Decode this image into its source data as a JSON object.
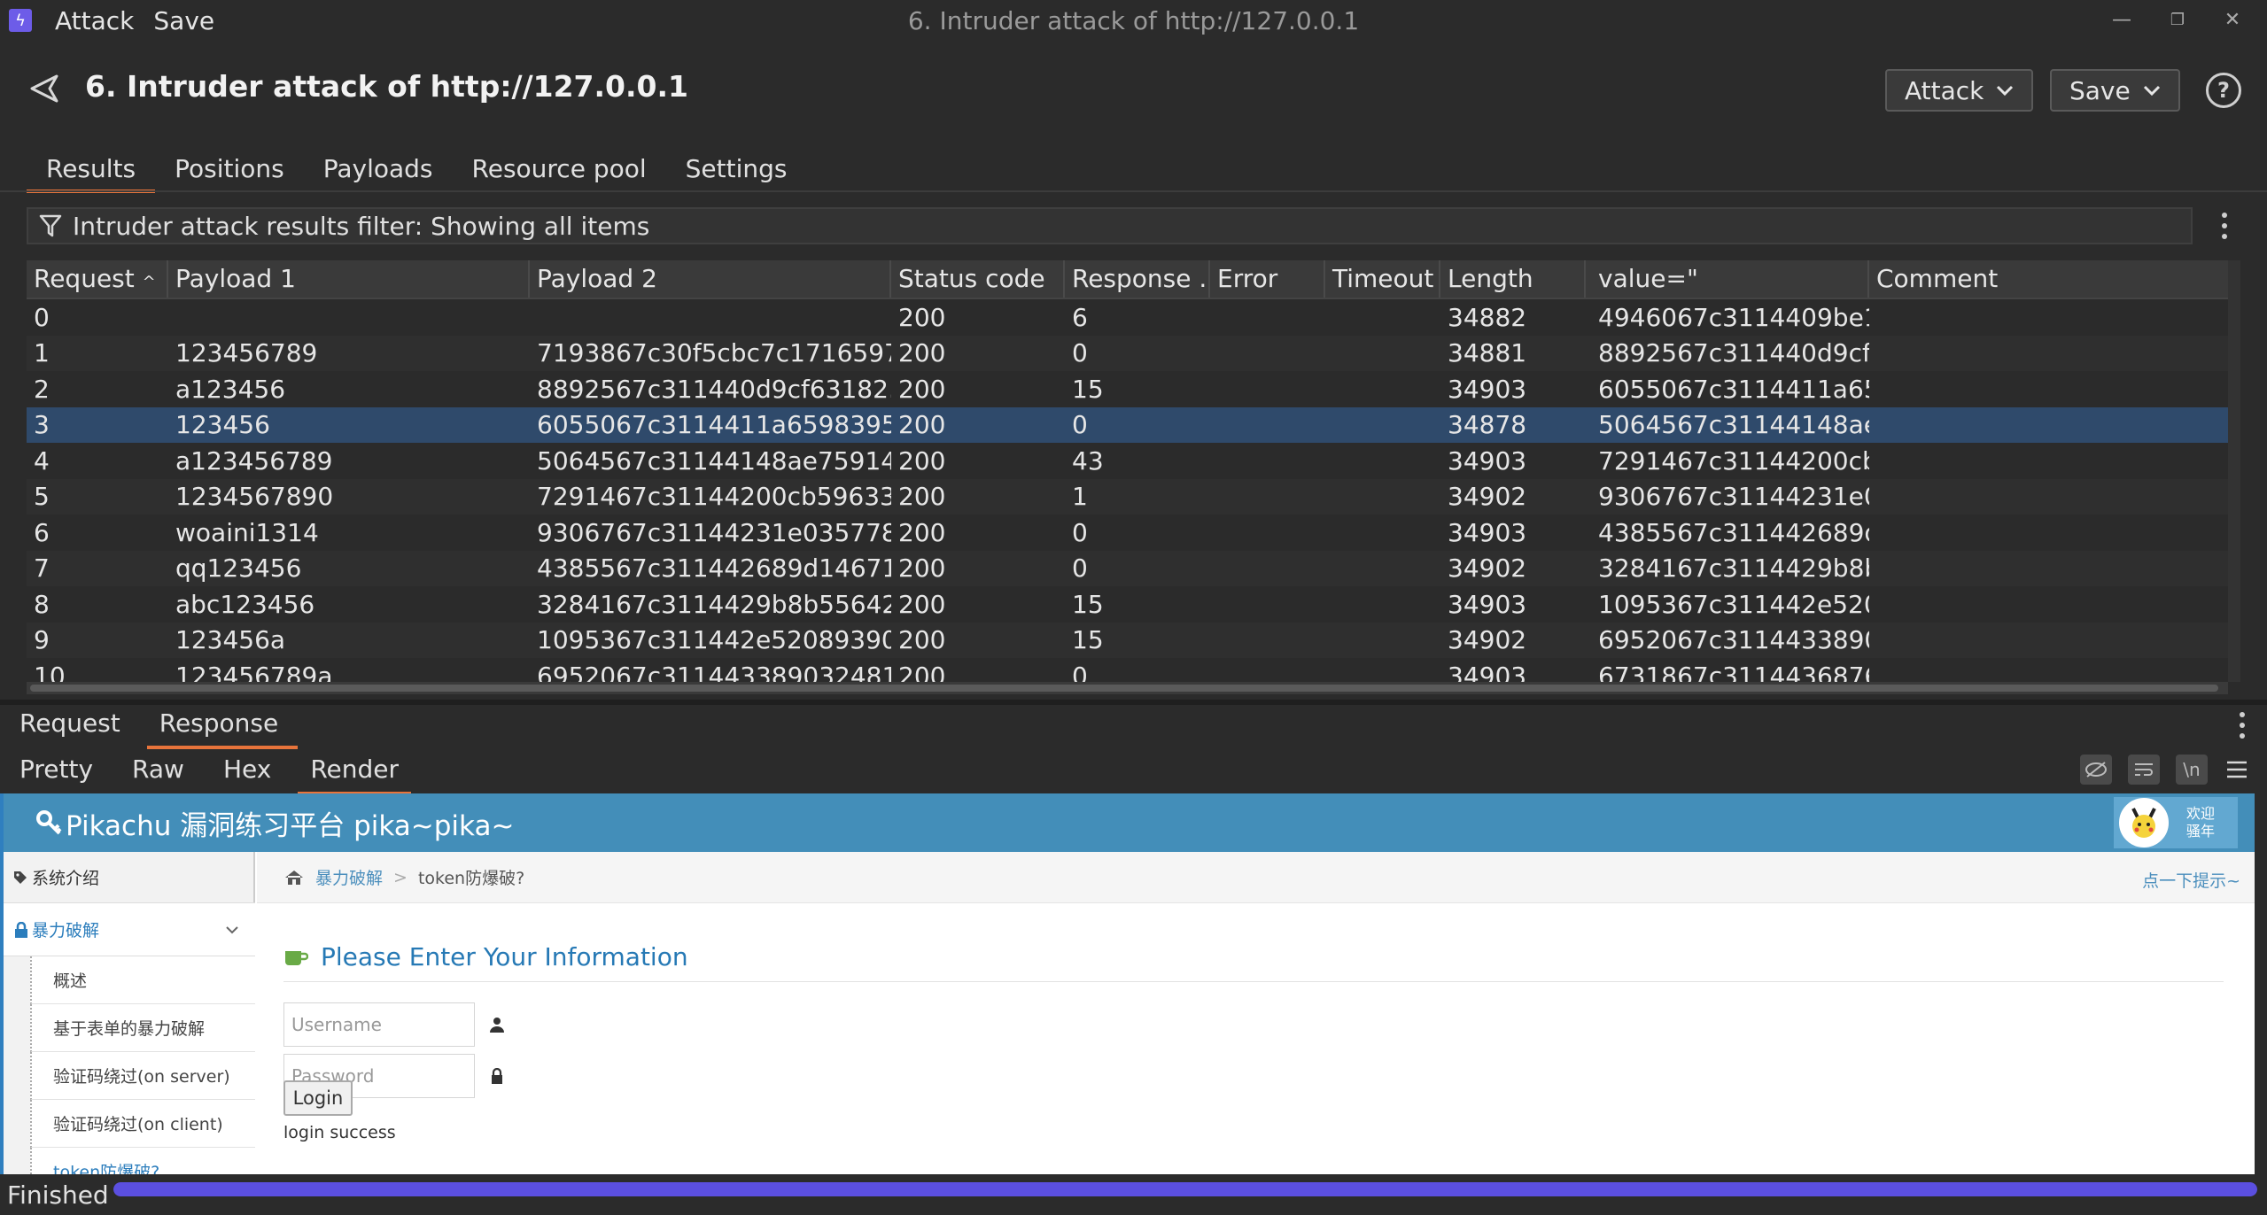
{
  "titlebar": {
    "menu": [
      "Attack",
      "Save"
    ],
    "window_title": "6. Intruder attack of http://127.0.0.1",
    "minimize": "—",
    "restore": "❐",
    "close": "✕"
  },
  "header": {
    "title": "6. Intruder attack of http://127.0.0.1",
    "attack_button": "Attack",
    "save_button": "Save",
    "help": "?"
  },
  "tabs": [
    "Results",
    "Positions",
    "Payloads",
    "Resource pool",
    "Settings"
  ],
  "filter": {
    "text": "Intruder attack results filter: Showing all items"
  },
  "table": {
    "columns": [
      "Request",
      "Payload 1",
      "Payload 2",
      "Status code",
      "Response ...",
      "Error",
      "Timeout",
      "Length",
      "value=\"",
      "Comment"
    ],
    "rows": [
      [
        "0",
        "",
        "",
        "200",
        "6",
        "",
        "",
        "34882",
        "4946067c3114409be1...",
        ""
      ],
      [
        "1",
        "123456789",
        "7193867c30f5cbc7c1716597...",
        "200",
        "0",
        "",
        "",
        "34881",
        "8892567c311440d9cf...",
        ""
      ],
      [
        "2",
        "a123456",
        "8892567c311440d9cf63182...",
        "200",
        "15",
        "",
        "",
        "34903",
        "6055067c3114411a65...",
        ""
      ],
      [
        "3",
        "123456",
        "6055067c3114411a6598395...",
        "200",
        "0",
        "",
        "",
        "34878",
        "5064567c31144148ae...",
        ""
      ],
      [
        "4",
        "a123456789",
        "5064567c31144148ae75914...",
        "200",
        "43",
        "",
        "",
        "34903",
        "7291467c31144200cb...",
        ""
      ],
      [
        "5",
        "1234567890",
        "7291467c31144200cb59633...",
        "200",
        "1",
        "",
        "",
        "34902",
        "9306767c31144231e0...",
        ""
      ],
      [
        "6",
        "woaini1314",
        "9306767c31144231e035778...",
        "200",
        "0",
        "",
        "",
        "34903",
        "4385567c311442689d...",
        ""
      ],
      [
        "7",
        "qq123456",
        "4385567c311442689d14671...",
        "200",
        "0",
        "",
        "",
        "34902",
        "3284167c3114429b8b...",
        ""
      ],
      [
        "8",
        "abc123456",
        "3284167c3114429b8b55642...",
        "200",
        "15",
        "",
        "",
        "34903",
        "1095367c311442e520...",
        ""
      ],
      [
        "9",
        "123456a",
        "1095367c311442e52089390...",
        "200",
        "15",
        "",
        "",
        "34902",
        "6952067c3114433890...",
        ""
      ],
      [
        "10",
        "123456789a",
        "6952067c311443389032481...",
        "200",
        "0",
        "",
        "",
        "34903",
        "6731867c3114436876...",
        ""
      ]
    ],
    "selected_row": 3,
    "sort_indicator": "^"
  },
  "message_tabs": [
    "Request",
    "Response"
  ],
  "view_tabs": [
    "Pretty",
    "Raw",
    "Hex",
    "Render"
  ],
  "render": {
    "site_title": "Pikachu 漏洞练习平台 pika~pika~",
    "welcome": [
      "欢迎",
      "骚年"
    ],
    "sidebar": {
      "intro": "系统介绍",
      "section": "暴力破解",
      "items": [
        "概述",
        "基于表单的暴力破解",
        "验证码绕过(on server)",
        "验证码绕过(on client)",
        "token防爆破?"
      ]
    },
    "breadcrumb": {
      "parent": "暴力破解",
      "separator": ">",
      "current": "token防爆破?"
    },
    "hint": "点一下提示~",
    "form_title": "Please Enter Your Information",
    "username_placeholder": "Username",
    "password_placeholder": "Password",
    "login_button": "Login",
    "message": "login success"
  },
  "status": {
    "text": "Finished",
    "progress": 1.0
  },
  "colors": {
    "accent": "#e8743b",
    "selected_row": "#2f4a6b",
    "progress": "#5b4fe0",
    "pikachu_bar": "#438eb9"
  }
}
